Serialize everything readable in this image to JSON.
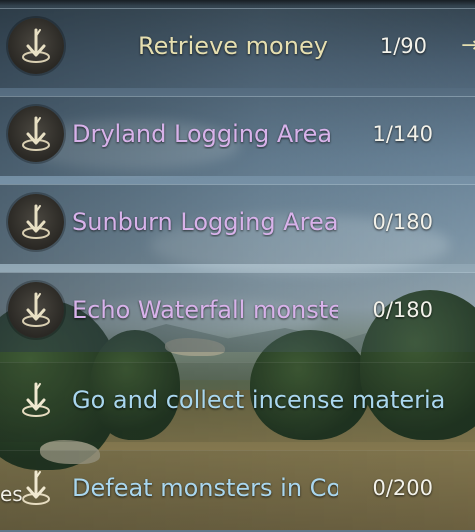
{
  "quests": [
    {
      "title": "Retrieve money",
      "progress": "1/90",
      "color": "#e6dfb0",
      "icon": "quest-arrow-icon",
      "align": "right"
    },
    {
      "title": "Dryland Logging Area",
      "progress": "1/140",
      "color": "#d8b2ea",
      "icon": "quest-arrow-icon"
    },
    {
      "title": "Sunburn Logging Area",
      "progress": "0/180",
      "color": "#d8b2ea",
      "icon": "quest-arrow-icon"
    },
    {
      "title": "Echo Waterfall monsters",
      "progress": "0/180",
      "color": "#d8b2ea",
      "icon": "quest-arrow-icon"
    },
    {
      "title": "Go and collect incense materia",
      "progress": "",
      "color": "#a9d6ee",
      "icon": "quest-arrow-icon"
    },
    {
      "title": "Defeat monsters in Co",
      "progress": "0/200",
      "color": "#a9d6ee",
      "icon": "quest-arrow-icon"
    }
  ],
  "edge": {
    "left_fragment": "es",
    "right_marker_icon": "arrow-marker-icon"
  },
  "colors": {
    "gold": "#e6dfb0",
    "purple": "#d8b2ea",
    "blue": "#a9d6ee"
  }
}
